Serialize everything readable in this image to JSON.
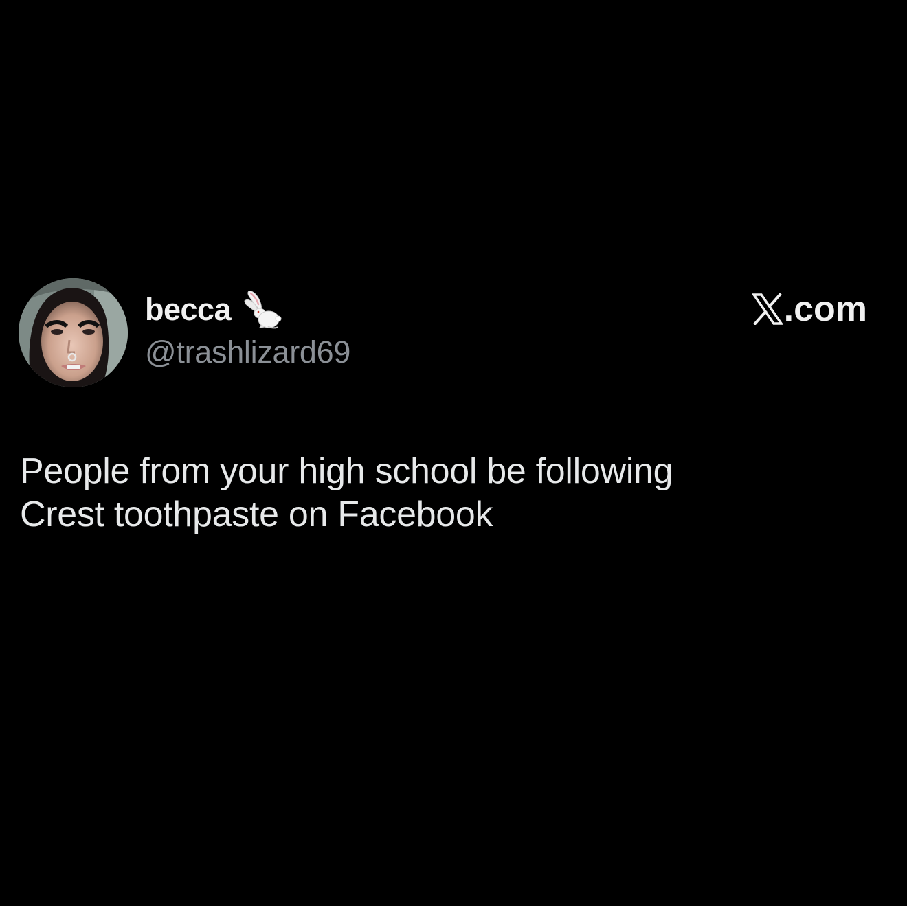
{
  "tweet": {
    "author": {
      "display_name": "becca",
      "name_emoji": "rabbit-icon",
      "handle": "@trashlizard69",
      "avatar": "avatar"
    },
    "brand": {
      "icon": "x-logo-icon",
      "label": ".com"
    },
    "text_lines": [
      "People from your high school be following",
      "Crest toothpaste on Facebook"
    ]
  },
  "colors": {
    "background": "#000000",
    "primary_text": "#e7e9ea",
    "secondary_text": "#8b9096"
  }
}
